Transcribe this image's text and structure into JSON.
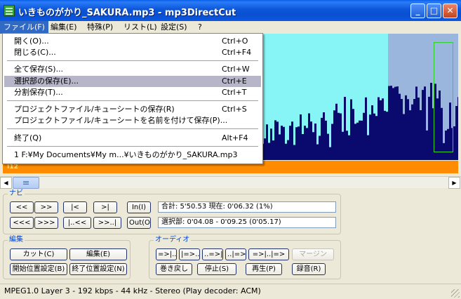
{
  "window": {
    "title": "いきものがかり_SAKURA.mp3 - mp3DirectCut",
    "minimize": "_",
    "maximize": "□",
    "close": "✕"
  },
  "menubar": [
    {
      "label": "ファイル(F)"
    },
    {
      "label": "編集(E)"
    },
    {
      "label": "特殊(P)"
    },
    {
      "label": "リスト(L)"
    },
    {
      "label": "設定(S)"
    },
    {
      "label": "?"
    }
  ],
  "file_menu": {
    "open": {
      "label": "開く(O)...",
      "shortcut": "Ctrl+O"
    },
    "close": {
      "label": "閉じる(C)...",
      "shortcut": "Ctrl+F4"
    },
    "save_all": {
      "label": "全て保存(S)...",
      "shortcut": "Ctrl+W"
    },
    "save_selection": {
      "label": "選択部の保存(E)...",
      "shortcut": "Ctrl+E"
    },
    "split_save": {
      "label": "分割保存(T)...",
      "shortcut": "Ctrl+T"
    },
    "save_project": {
      "label": "プロジェクトファイル/キューシートの保存(R)",
      "shortcut": "Ctrl+S"
    },
    "save_project_as": {
      "label": "プロジェクトファイル/キューシートを名前を付けて保存(P)...",
      "shortcut": ""
    },
    "exit": {
      "label": "終了(Q)",
      "shortcut": "Alt+F4"
    },
    "recent_1": {
      "label": "1 F:¥My Documents¥My m...¥いきものがかり_SAKURA.mp3",
      "shortcut": ""
    }
  },
  "waveform": {
    "marker": "I12",
    "colors": {
      "background": "#87f5f5",
      "selection": "#9ab6dc",
      "wave": "#0a0a6e",
      "timeline": "#ff8c00",
      "cursor_box": "#2fd22f"
    }
  },
  "scrollbar": {
    "left_arrow": "◀",
    "right_arrow": "▶"
  },
  "navi": {
    "title": "ナビ",
    "buttons": [
      "<<",
      ">>",
      "|<",
      ">|",
      "In(I)",
      "<<<",
      ">>>",
      "|..<<",
      ">>..|",
      "Out(O)"
    ],
    "total_readout": "合計: 5'50.53   現在: 0'06.32   (1%)",
    "selection_readout": "選択部: 0'04.08 - 0'09.25 (0'05.17)"
  },
  "edit": {
    "title": "編集",
    "cut": "カット(C)",
    "edit": "編集(E)",
    "set_start": "開始位置設定(B)",
    "set_end": "終了位置設定(N)"
  },
  "audio": {
    "title": "オーディオ",
    "row1": [
      "=>|..",
      "|=>..",
      "..=>|",
      "..|=>",
      "=>|..|=>"
    ],
    "margin": "マージン",
    "rewind": "巻き戻し",
    "stop": "停止(S)",
    "play": "再生(P)",
    "record": "録音(R)"
  },
  "status": {
    "text": "MPEG1.0 Layer 3 - 192 kbps - 44 kHz - Stereo    (Play decoder: ACM)"
  }
}
